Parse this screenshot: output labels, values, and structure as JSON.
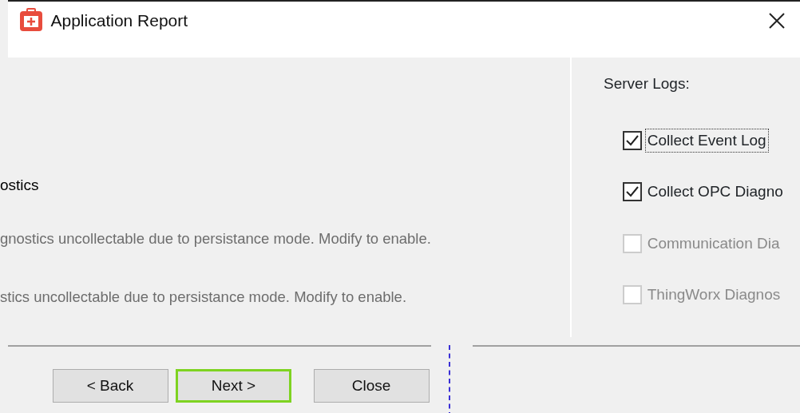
{
  "window": {
    "title": "Application Report"
  },
  "left_panel": {
    "heading": "ostics",
    "notes": [
      {
        "text": "gnostics uncollectable due to persistance mode. Modify to enable.",
        "disabled": true
      },
      {
        "text": "stics uncollectable due to persistance mode. Modify to enable.",
        "disabled": true
      }
    ]
  },
  "server_logs": {
    "label": "Server Logs:",
    "options": [
      {
        "label": "Collect Event Log",
        "checked": true,
        "disabled": false,
        "focused": true
      },
      {
        "label": "Collect OPC Diagno",
        "checked": true,
        "disabled": false,
        "focused": false
      },
      {
        "label": "Communication Dia",
        "checked": false,
        "disabled": true,
        "focused": false
      },
      {
        "label": "ThingWorx Diagnos",
        "checked": false,
        "disabled": true,
        "focused": false
      }
    ]
  },
  "buttons": [
    {
      "label": "< Back",
      "default": false
    },
    {
      "label": "Next >",
      "default": true
    },
    {
      "label": "Close",
      "default": false
    }
  ]
}
